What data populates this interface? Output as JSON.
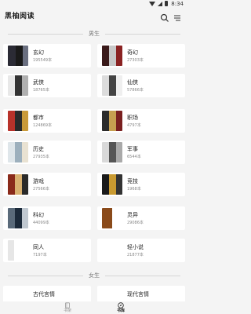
{
  "status": {
    "time": "8:34"
  },
  "app": {
    "title": "黑柚阅读"
  },
  "sections": {
    "male": "男生",
    "female": "女生"
  },
  "male_categories": [
    {
      "name": "玄幻",
      "count": "195549本"
    },
    {
      "name": "奇幻",
      "count": "27303本"
    },
    {
      "name": "武侠",
      "count": "18765本"
    },
    {
      "name": "仙侠",
      "count": "57866本"
    },
    {
      "name": "都市",
      "count": "124869本"
    },
    {
      "name": "职场",
      "count": "4797本"
    },
    {
      "name": "历史",
      "count": "27935本"
    },
    {
      "name": "军事",
      "count": "6544本"
    },
    {
      "name": "游戏",
      "count": "27566本"
    },
    {
      "name": "竞技",
      "count": "1968本"
    },
    {
      "name": "科幻",
      "count": "44099本"
    },
    {
      "name": "灵异",
      "count": "29086本"
    },
    {
      "name": "同人",
      "count": "7197本"
    },
    {
      "name": "轻小说",
      "count": "21877本"
    }
  ],
  "female_categories": [
    {
      "name": "古代言情",
      "count": ""
    },
    {
      "name": "现代言情",
      "count": ""
    }
  ],
  "bottom_nav": {
    "bookshelf": "书架",
    "bookstore": "书库"
  },
  "colors": {
    "accent": "#222222",
    "card": "#ffffff",
    "bg": "#f4f4f4"
  }
}
